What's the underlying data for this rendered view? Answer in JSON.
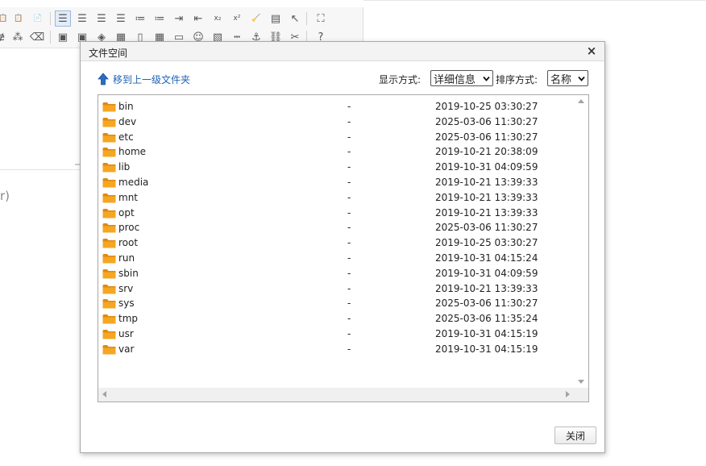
{
  "editor": {
    "toolbar": {
      "row1": [
        {
          "icon": "paste-icon",
          "glyph": "📋",
          "active": false
        },
        {
          "icon": "paste-text-icon",
          "glyph": "📋",
          "active": false
        },
        {
          "icon": "paste-word-icon",
          "glyph": "📄",
          "active": false
        },
        {
          "icon": "align-left-icon",
          "glyph": "☰",
          "active": true
        },
        {
          "icon": "align-center-icon",
          "glyph": "☰",
          "active": false
        },
        {
          "icon": "align-right-icon",
          "glyph": "☰",
          "active": false
        },
        {
          "icon": "align-justify-icon",
          "glyph": "☰",
          "active": false
        },
        {
          "icon": "ordered-list-icon",
          "glyph": "≔",
          "active": false
        },
        {
          "icon": "unordered-list-icon",
          "glyph": "≔",
          "active": false
        },
        {
          "icon": "indent-icon",
          "glyph": "⇥",
          "active": false
        },
        {
          "icon": "outdent-icon",
          "glyph": "⇤",
          "active": false
        },
        {
          "icon": "subscript-icon",
          "glyph": "x₂",
          "active": false
        },
        {
          "icon": "superscript-icon",
          "glyph": "x²",
          "active": false
        },
        {
          "icon": "clear-format-icon",
          "glyph": "🧹",
          "active": false
        },
        {
          "icon": "select-all-icon",
          "glyph": "▤",
          "active": false
        },
        {
          "icon": "cursor-icon",
          "glyph": "↖",
          "active": false
        },
        {
          "icon": "fullscreen-icon",
          "glyph": "⛶",
          "active": false
        }
      ],
      "row2": [
        {
          "icon": "strikethrough-icon",
          "glyph": "ɇ"
        },
        {
          "icon": "horizontal-rule-icon",
          "glyph": "⁂"
        },
        {
          "icon": "eraser-icon",
          "glyph": "⌫"
        },
        {
          "icon": "insert-image-icon",
          "glyph": "▣"
        },
        {
          "icon": "multi-image-icon",
          "glyph": "▣"
        },
        {
          "icon": "flash-icon",
          "glyph": "◈"
        },
        {
          "icon": "media-icon",
          "glyph": "▦"
        },
        {
          "icon": "file-icon",
          "glyph": "▯"
        },
        {
          "icon": "table-icon",
          "glyph": "▦"
        },
        {
          "icon": "insert-code-icon",
          "glyph": "▭"
        },
        {
          "icon": "emoticon-icon",
          "glyph": "☺"
        },
        {
          "icon": "template-icon",
          "glyph": "▧"
        },
        {
          "icon": "page-break-icon",
          "glyph": "┅"
        },
        {
          "icon": "anchor-icon",
          "glyph": "⚓"
        },
        {
          "icon": "link-icon",
          "glyph": "⛓"
        },
        {
          "icon": "unlink-icon",
          "glyph": "✂"
        },
        {
          "icon": "help-icon",
          "glyph": "?"
        }
      ]
    },
    "fragment_text": "r)"
  },
  "dialog": {
    "title": "文件空间",
    "close_glyph": "×",
    "up_link": "移到上一级文件夹",
    "view_label": "显示方式:",
    "view_selected": "详细信息",
    "sort_label": "排序方式:",
    "sort_selected": "名称",
    "close_button": "关闭",
    "files": [
      {
        "name": "bin",
        "size": "-",
        "date": "2019-10-25 03:30:27"
      },
      {
        "name": "dev",
        "size": "-",
        "date": "2025-03-06 11:30:27"
      },
      {
        "name": "etc",
        "size": "-",
        "date": "2025-03-06 11:30:27"
      },
      {
        "name": "home",
        "size": "-",
        "date": "2019-10-21 20:38:09"
      },
      {
        "name": "lib",
        "size": "-",
        "date": "2019-10-31 04:09:59"
      },
      {
        "name": "media",
        "size": "-",
        "date": "2019-10-21 13:39:33"
      },
      {
        "name": "mnt",
        "size": "-",
        "date": "2019-10-21 13:39:33"
      },
      {
        "name": "opt",
        "size": "-",
        "date": "2019-10-21 13:39:33"
      },
      {
        "name": "proc",
        "size": "-",
        "date": "2025-03-06 11:30:27"
      },
      {
        "name": "root",
        "size": "-",
        "date": "2019-10-25 03:30:27"
      },
      {
        "name": "run",
        "size": "-",
        "date": "2019-10-31 04:15:24"
      },
      {
        "name": "sbin",
        "size": "-",
        "date": "2019-10-31 04:09:59"
      },
      {
        "name": "srv",
        "size": "-",
        "date": "2019-10-21 13:39:33"
      },
      {
        "name": "sys",
        "size": "-",
        "date": "2025-03-06 11:30:27"
      },
      {
        "name": "tmp",
        "size": "-",
        "date": "2025-03-06 11:35:24"
      },
      {
        "name": "usr",
        "size": "-",
        "date": "2019-10-31 04:15:19"
      },
      {
        "name": "var",
        "size": "-",
        "date": "2019-10-31 04:15:19"
      }
    ]
  },
  "colors": {
    "link": "#1e62b6",
    "folder": "#f5a623",
    "folder_dark": "#e08a10",
    "up_arrow": "#2b6cc4"
  }
}
